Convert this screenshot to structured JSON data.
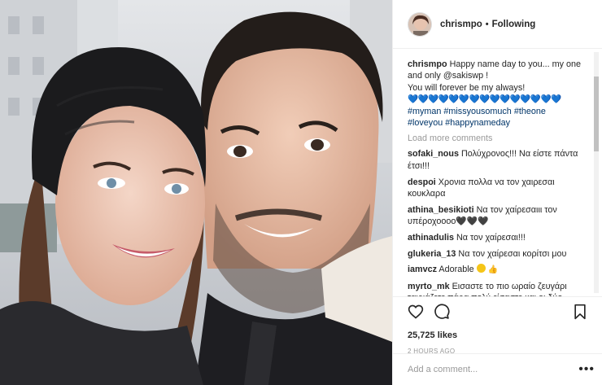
{
  "post": {
    "username": "chrismpo",
    "follow_status": "Following",
    "caption": {
      "username": "chrismpo",
      "text": "Happy name day to you... my one and only @sakiswp !",
      "line2": "You will forever be my always!",
      "hearts": "💙💙💙💙💙💙💙💙💙💙💙💙💙💙💙",
      "hashtags": [
        "#myman",
        "#missyousomuch",
        "#theone",
        "#loveyou",
        "#happynameday"
      ]
    },
    "load_more_label": "Load more comments",
    "comments": [
      {
        "user": "sofaki_nous",
        "text": "Πολύχρονος!!! Να είστε πάντα έτσι!!!"
      },
      {
        "user": "despoi",
        "text": "Χρονια πολλα να τον χαιρεσαι κουκλαρα"
      },
      {
        "user": "athina_besikioti",
        "text": "Να τον χαίρεσαιιι τον υπέροχοοοο🖤🖤🖤"
      },
      {
        "user": "athinadulis",
        "text": "Να τον χαίρεσαι!!!"
      },
      {
        "user": "glukeria_13",
        "text": "Να τον χαίρεσαι κορίτσι μου"
      },
      {
        "user": "iamvcz",
        "text": "Adorable"
      },
      {
        "user": "myrto_mk",
        "text": "Εισαστε το πιο ωραίο ζευγάρι ταιριάζετε πάρα πολύ είσαστε και οι δύο"
      }
    ],
    "likes": "25,725 likes",
    "time_ago": "2 HOURS AGO",
    "add_comment_placeholder": "Add a comment...",
    "more_options": "•••"
  },
  "icons": {
    "like": "heart-icon",
    "comment": "comment-icon",
    "save": "bookmark-icon",
    "more": "more-options-icon"
  },
  "colors": {
    "text": "#262626",
    "muted": "#999999",
    "hashtag": "#003569",
    "hearts": "#0fb5b0",
    "border": "#efefef"
  }
}
